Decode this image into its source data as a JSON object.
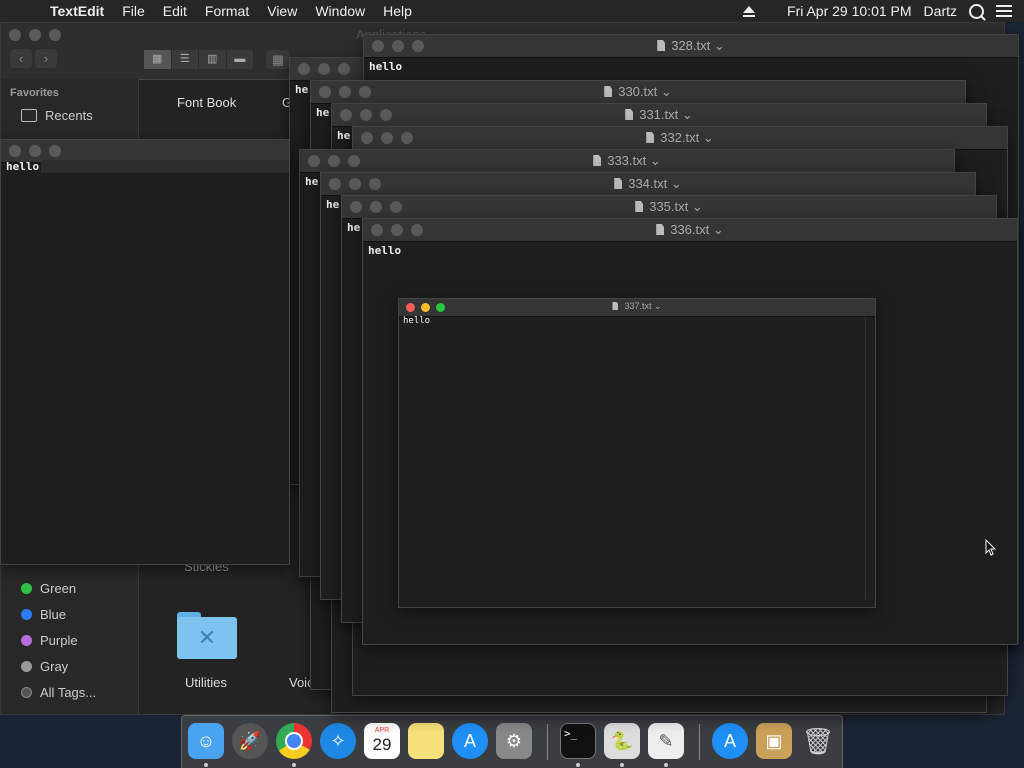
{
  "menubar": {
    "app_name": "TextEdit",
    "items": [
      "File",
      "Edit",
      "Format",
      "View",
      "Window",
      "Help"
    ],
    "datetime": "Fri Apr 29  10:01 PM",
    "user": "Dartz"
  },
  "finder": {
    "title": "Applications",
    "sidebar": {
      "favorites_header": "Favorites",
      "recents": "Recents",
      "tags": [
        {
          "label": "Green",
          "color": "#30c048"
        },
        {
          "label": "Blue",
          "color": "#2e7cf6"
        },
        {
          "label": "Purple",
          "color": "#b86ee0"
        },
        {
          "label": "Gray",
          "color": "#9a9a9a"
        },
        {
          "label": "All Tags...",
          "color": "#555555"
        }
      ]
    },
    "files": {
      "font_book": "Font Book",
      "g_partial": "G",
      "stickies": "Stickies",
      "utilities": "Utilities",
      "voice_memos": "Voice Me"
    }
  },
  "windows": {
    "w_left": {
      "content": "hello"
    },
    "w328": {
      "title": "328.txt",
      "content": "hello"
    },
    "w330": {
      "title": "330.txt"
    },
    "w331": {
      "title": "331.txt"
    },
    "w332": {
      "title": "332.txt"
    },
    "w333": {
      "title": "333.txt"
    },
    "w334": {
      "title": "334.txt"
    },
    "w335": {
      "title": "335.txt"
    },
    "w336": {
      "title": "336.txt",
      "content": "hello"
    },
    "w337": {
      "title": "337.txt",
      "content": "hello"
    },
    "partial_he": "he"
  },
  "dock": {
    "calendar_month": "APR",
    "calendar_day": "29",
    "apps": [
      "finder",
      "launchpad",
      "chrome",
      "safari",
      "calendar",
      "notes",
      "app-store",
      "system-preferences",
      "terminal",
      "python",
      "textedit",
      "app-store-2",
      "archive-utility",
      "trash"
    ]
  }
}
